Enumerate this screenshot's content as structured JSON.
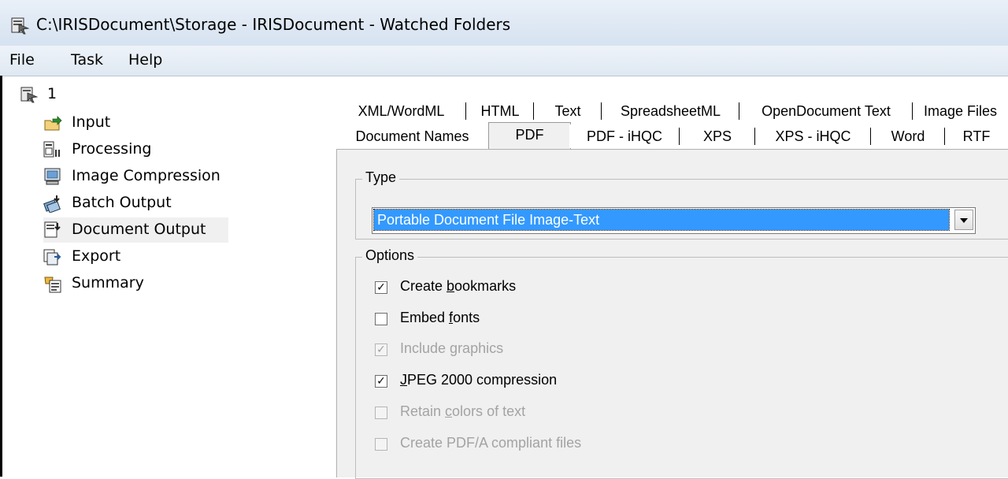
{
  "window": {
    "title": "C:\\IRISDocument\\Storage - IRISDocument - Watched Folders"
  },
  "menu": [
    "File",
    "Task",
    "Help"
  ],
  "tree": {
    "root": "1",
    "items": [
      {
        "label": "Input",
        "icon": "input-icon"
      },
      {
        "label": "Processing",
        "icon": "processing-icon"
      },
      {
        "label": "Image Compression",
        "icon": "image-compression-icon"
      },
      {
        "label": "Batch Output",
        "icon": "batch-output-icon"
      },
      {
        "label": "Document Output",
        "icon": "document-output-icon",
        "selected": true
      },
      {
        "label": "Export",
        "icon": "export-icon"
      },
      {
        "label": "Summary",
        "icon": "summary-icon"
      }
    ]
  },
  "tabs": {
    "row1": [
      "XML/WordML",
      "HTML",
      "Text",
      "SpreadsheetML",
      "OpenDocument Text",
      "Image Files"
    ],
    "row2": [
      "Document Names",
      "PDF",
      "PDF - iHQC",
      "XPS",
      "XPS - iHQC",
      "Word",
      "RTF"
    ],
    "active": "PDF"
  },
  "type_group": {
    "title": "Type",
    "selected": "Portable Document File Image-Text"
  },
  "options_group": {
    "title": "Options",
    "items": [
      {
        "pre": "Create ",
        "u": "b",
        "post": "ookmarks",
        "checked": true,
        "enabled": true
      },
      {
        "pre": "Embed ",
        "u": "f",
        "post": "onts",
        "checked": false,
        "enabled": true
      },
      {
        "pre": "Include ",
        "u": "g",
        "post": "raphics",
        "checked": true,
        "enabled": false
      },
      {
        "pre": "",
        "u": "J",
        "post": "PEG 2000 compression",
        "checked": true,
        "enabled": true
      },
      {
        "pre": "Retain ",
        "u": "c",
        "post": "olors of text",
        "checked": false,
        "enabled": false
      },
      {
        "pre": "Create PDF/A compliant files",
        "u": "",
        "post": "",
        "checked": false,
        "enabled": false
      }
    ]
  },
  "colors": {
    "selection": "#3399ff",
    "panel": "#f0f0f0"
  }
}
